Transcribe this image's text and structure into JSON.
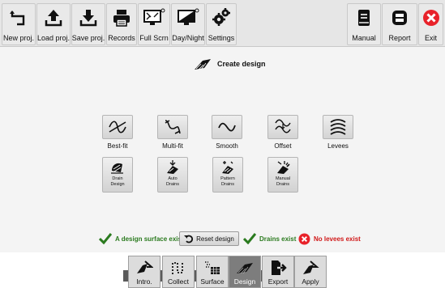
{
  "toolbar": {
    "new_proj": "New proj.",
    "load_proj": "Load proj.",
    "save_proj": "Save proj.",
    "records": "Records",
    "full_scrn": "Full Scrn",
    "day_night": "Day/Night",
    "settings": "Settings",
    "manual": "Manual",
    "report": "Report",
    "exit": "Exit"
  },
  "main": {
    "title": "Create design",
    "actions": {
      "best_fit": "Best-fit",
      "multi_fit": "Multi-fit",
      "smooth": "Smooth",
      "offset": "Offset",
      "levees": "Levees"
    },
    "drains": {
      "drain_design_1": "Drain",
      "drain_design_2": "Design",
      "auto_drains_1": "Auto",
      "auto_drains_2": "Drains",
      "pattern_drains_1": "Pattern",
      "pattern_drains_2": "Drains",
      "manual_drains_1": "Manual",
      "manual_drains_2": "Drains"
    },
    "status": {
      "design_surface": "A design surface exists",
      "reset_design": "Reset design",
      "drains_exist": "Drains exist",
      "no_levees": "No levees exist"
    }
  },
  "nav": {
    "intro": "Intro.",
    "collect": "Collect",
    "surface": "Surface",
    "design": "Design",
    "export": "Export",
    "apply": "Apply"
  },
  "colors": {
    "ok_green": "#2a7a1e",
    "error_red": "#d01818",
    "active_tab": "#7d7d7d"
  }
}
